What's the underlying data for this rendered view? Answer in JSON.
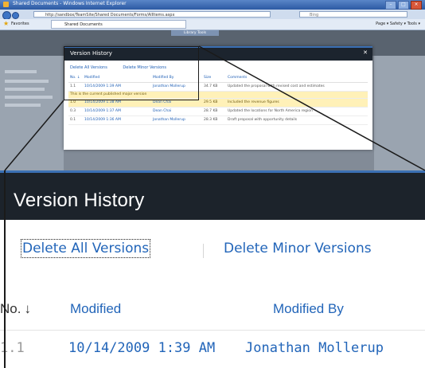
{
  "browser": {
    "window_title": "Shared Documents - Windows Internet Explorer",
    "address": "http://sandbox/TeamSite/Shared Documents/Forms/AllItems.aspx",
    "search_placeholder": "Bing",
    "favorites_label": "Favorites",
    "tab_label": "Shared Documents",
    "toolbar_commands": "Page ▾  Safety ▾  Tools ▾"
  },
  "sharepoint": {
    "ribbon_tab": "Library Tools"
  },
  "dialog_small": {
    "title": "Version History",
    "delete_all": "Delete All Versions",
    "delete_minor": "Delete Minor Versions",
    "columns": [
      "No. ↓",
      "Modified",
      "Modified By",
      "Size",
      "Comments"
    ],
    "current_note": "This is the current published major version",
    "rows": [
      {
        "no": "1.1",
        "modified": "10/14/2009 1:39 AM",
        "by": "Jonathan Mollerup",
        "size": "34.7 KB",
        "comments": "Updated the proposal with revised cost and estimates"
      },
      {
        "no": "1.0",
        "modified": "10/14/2009 1:38 AM",
        "by": "Dean Chai",
        "size": "29.5 KB",
        "comments": "Included the revenue figures"
      },
      {
        "no": "0.3",
        "modified": "10/14/2009 1:37 AM",
        "by": "Dean Chai",
        "size": "28.7 KB",
        "comments": "Updated the locations for North America region"
      },
      {
        "no": "0.1",
        "modified": "10/14/2009 1:36 AM",
        "by": "Jonathan Mollerup",
        "size": "28.3 KB",
        "comments": "Draft proposal with opportunity details"
      }
    ]
  },
  "zoom": {
    "title": "Version History",
    "delete_all": "Delete All Versions",
    "delete_minor": "Delete Minor Versions",
    "col_no": "No.",
    "col_no_arrow": "↓",
    "col_modified": "Modified",
    "col_modified_by": "Modified By",
    "row": {
      "no": "1.1",
      "modified": "10/14/2009 1:39 AM",
      "by": "Jonathan Mollerup"
    }
  },
  "colors": {
    "header": "#1c232b",
    "accent": "#3b70b4",
    "link": "#2265b9"
  },
  "icons": [
    "ie-logo-icon",
    "back-icon",
    "forward-icon",
    "favorites-star-icon",
    "close-icon",
    "sort-down-arrow-icon"
  ]
}
